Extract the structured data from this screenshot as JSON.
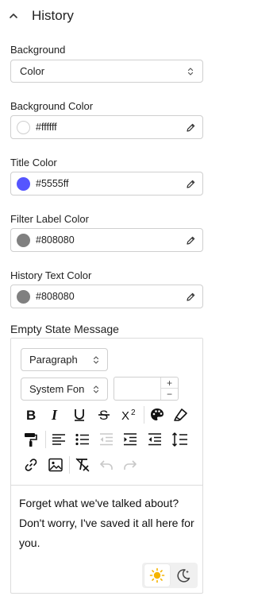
{
  "section": {
    "title": "History",
    "icon": "chevron-up-icon"
  },
  "background": {
    "label": "Background",
    "value": "Color"
  },
  "fields": [
    {
      "label": "Background Color",
      "value": "#ffffff",
      "swatch": "#ffffff"
    },
    {
      "label": "Title Color",
      "value": "#5555ff",
      "swatch": "#5555ff"
    },
    {
      "label": "Filter Label Color",
      "value": "#808080",
      "swatch": "#808080"
    },
    {
      "label": "History Text Color",
      "value": "#808080",
      "swatch": "#808080"
    }
  ],
  "editor": {
    "label": "Empty State Message",
    "block_format": "Paragraph",
    "font_family": "System Fon",
    "font_size": "",
    "content": "Forget what we've talked about? Don't worry, I've saved it all here for you.",
    "toolbar_icons": [
      "bold-icon",
      "italic-icon",
      "underline-icon",
      "strikethrough-icon",
      "superscript-icon",
      "palette-icon",
      "highlighter-icon",
      "paint-roller-icon",
      "align-left-icon",
      "bullet-list-icon",
      "outdent-icon",
      "indent-icon",
      "outdent-alt-icon",
      "line-height-icon",
      "link-icon",
      "image-icon",
      "clear-format-icon",
      "undo-icon",
      "redo-icon"
    ],
    "theme": {
      "active": "light",
      "light_icon": "sun-icon",
      "dark_icon": "moon-icon"
    }
  },
  "colors": {
    "accent_sun": "#f5b400",
    "border": "#cfcfcf"
  }
}
